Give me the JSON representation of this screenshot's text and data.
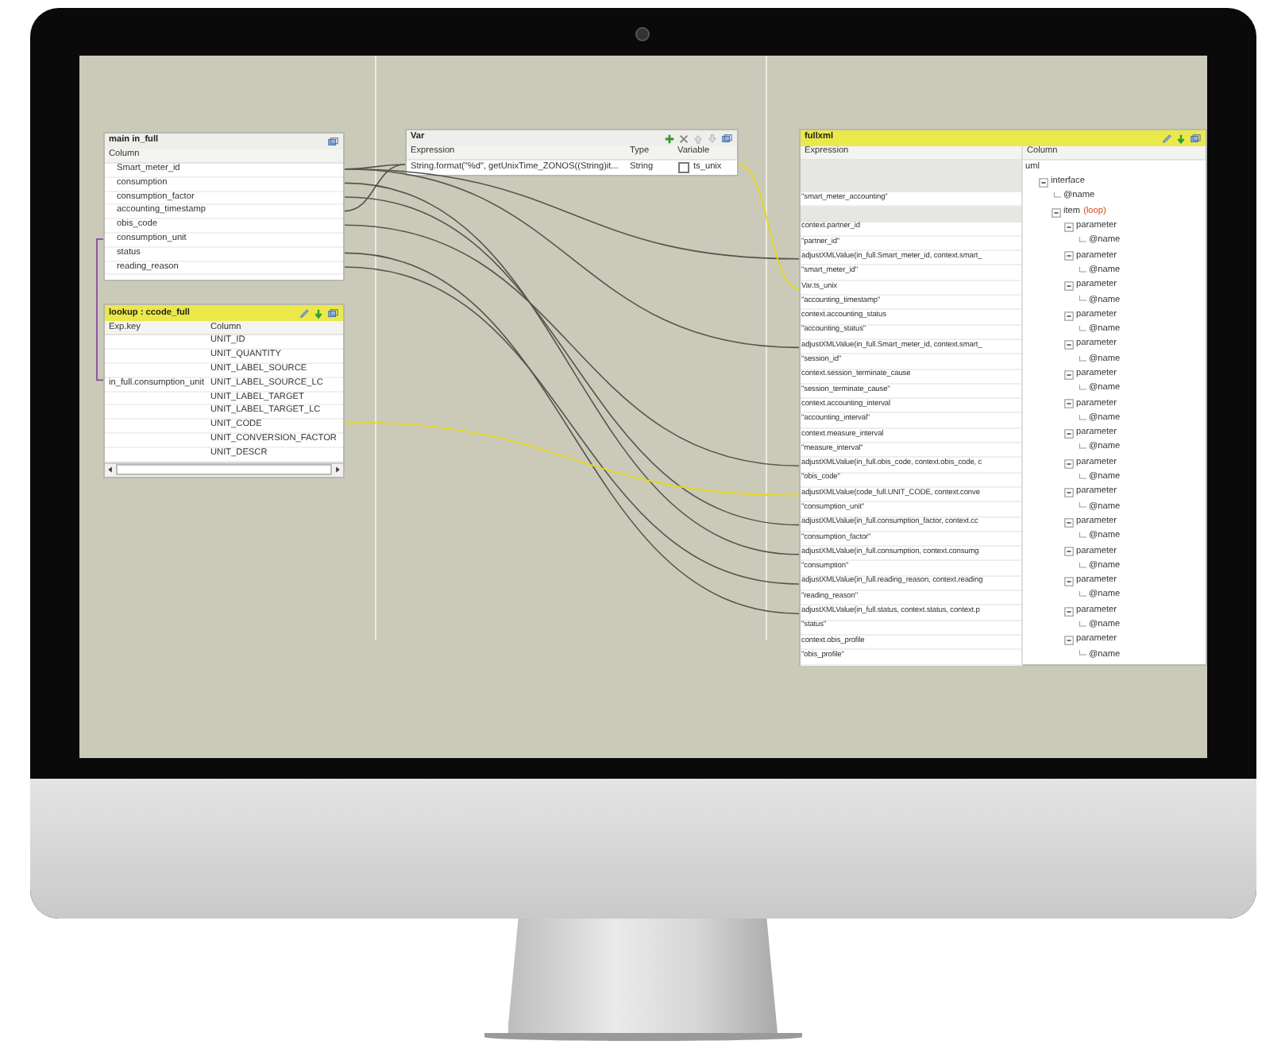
{
  "main_panel": {
    "title": "main in_full",
    "column_header": "Column",
    "rows": [
      {
        "label": "Smart_meter_id"
      },
      {
        "label": "consumption"
      },
      {
        "label": "consumption_factor"
      },
      {
        "label": "accounting_timestamp"
      },
      {
        "label": "obis_code"
      },
      {
        "label": "consumption_unit"
      },
      {
        "label": "status"
      },
      {
        "label": "reading_reason"
      }
    ]
  },
  "lookup_panel": {
    "title": "lookup : ccode_full",
    "headers": [
      "Exp.key",
      "Column"
    ],
    "rows": [
      {
        "column": "UNIT_ID"
      },
      {
        "column": "UNIT_QUANTITY"
      },
      {
        "column": "UNIT_LABEL_SOURCE"
      },
      {
        "exp_key": "in_full.consumption_unit",
        "column": "UNIT_LABEL_SOURCE_LC"
      },
      {
        "column": "UNIT_LABEL_TARGET"
      },
      {
        "column": "UNIT_LABEL_TARGET_LC"
      },
      {
        "column": "UNIT_CODE"
      },
      {
        "column": "UNIT_CONVERSION_FACTOR"
      },
      {
        "column": "UNIT_DESCR"
      }
    ]
  },
  "var_panel": {
    "title": "Var",
    "headers": [
      "Expression",
      "Type",
      "Variable"
    ],
    "rows": [
      {
        "expression": "String.format(\"%d\", getUnixTime_ZONOS((String)it...",
        "type": "String",
        "checked": false,
        "variable": "ts_unix"
      }
    ]
  },
  "output_panel": {
    "title": "fullxml",
    "expression_header": "Expression",
    "column_header": "Column",
    "expressions": [
      "\"smart_meter_accounting\"",
      "context.partner_id",
      "\"partner_id\"",
      "adjustXMLValue(in_full.Smart_meter_id, context.smart_",
      "\"smart_meter_id\"",
      "Var.ts_unix",
      "\"accounting_timestamp\"",
      "context.accounting_status",
      "\"accounting_status\"",
      "adjustXMLValue(in_full.Smart_meter_id, context.smart_",
      "\"session_id\"",
      "context.session_terminate_cause",
      "\"session_terminate_cause\"",
      "context.accounting_interval",
      "\"accounting_interval\"",
      "context.measure_interval",
      "\"measure_interval\"",
      "adjustXMLValue(in_full.obis_code, context.obis_code, c",
      "\"obis_code\"",
      "adjustXMLValue(code_full.UNIT_CODE, context.conve",
      "\"consumption_unit\"",
      "adjustXMLValue(in_full.consumption_factor, context.cc",
      "\"consumption_factor\"",
      "adjustXMLValue(in_full.consumption, context.consumg",
      "\"consumption\"",
      "adjustXMLValue(in_full.reading_reason, context.reading",
      "\"reading_reason\"",
      "adjustXMLValue(in_full.status, context.status, context.p",
      "\"status\"",
      "context.obis_profile",
      "\"obis_profile\""
    ],
    "tree": [
      {
        "label": "uml",
        "children": [
          {
            "label": "interface",
            "expanded": true,
            "children": [
              {
                "label": "@name"
              },
              {
                "label": "item",
                "tag": "(loop)",
                "expanded": true,
                "children": [
                  {
                    "label": "parameter",
                    "expanded": true,
                    "children": [
                      {
                        "label": "@name"
                      }
                    ]
                  },
                  {
                    "label": "parameter",
                    "expanded": true,
                    "children": [
                      {
                        "label": "@name"
                      }
                    ]
                  },
                  {
                    "label": "parameter",
                    "expanded": true,
                    "children": [
                      {
                        "label": "@name"
                      }
                    ]
                  },
                  {
                    "label": "parameter",
                    "expanded": true,
                    "children": [
                      {
                        "label": "@name"
                      }
                    ]
                  },
                  {
                    "label": "parameter",
                    "expanded": true,
                    "children": [
                      {
                        "label": "@name"
                      }
                    ]
                  },
                  {
                    "label": "parameter",
                    "expanded": true,
                    "children": [
                      {
                        "label": "@name"
                      }
                    ]
                  },
                  {
                    "label": "parameter",
                    "expanded": true,
                    "children": [
                      {
                        "label": "@name"
                      }
                    ]
                  },
                  {
                    "label": "parameter",
                    "expanded": true,
                    "children": [
                      {
                        "label": "@name"
                      }
                    ]
                  },
                  {
                    "label": "parameter",
                    "expanded": true,
                    "children": [
                      {
                        "label": "@name"
                      }
                    ]
                  },
                  {
                    "label": "parameter",
                    "expanded": true,
                    "children": [
                      {
                        "label": "@name"
                      }
                    ]
                  },
                  {
                    "label": "parameter",
                    "expanded": true,
                    "children": [
                      {
                        "label": "@name"
                      }
                    ]
                  },
                  {
                    "label": "parameter",
                    "expanded": true,
                    "children": [
                      {
                        "label": "@name"
                      }
                    ]
                  },
                  {
                    "label": "parameter",
                    "expanded": true,
                    "children": [
                      {
                        "label": "@name"
                      }
                    ]
                  },
                  {
                    "label": "parameter",
                    "expanded": true,
                    "children": [
                      {
                        "label": "@name"
                      }
                    ]
                  },
                  {
                    "label": "parameter",
                    "expanded": true,
                    "children": [
                      {
                        "label": "@name"
                      }
                    ]
                  }
                ]
              }
            ]
          }
        ]
      }
    ]
  }
}
